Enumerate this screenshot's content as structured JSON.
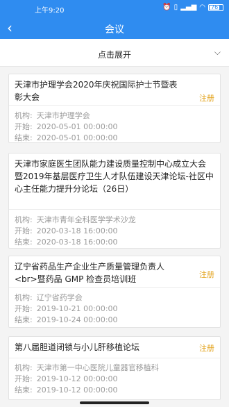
{
  "status": {
    "time": "上午9:20",
    "icons": [
      "alarm-icon",
      "sim-icon",
      "signal-icon",
      "wifi-icon"
    ],
    "battery": "76"
  },
  "header": {
    "title": "会议",
    "accent": "#2f8cf0"
  },
  "expand_bar": {
    "label": "点击展开",
    "icon": "chevron-down-icon"
  },
  "labels": {
    "org": "机构:",
    "start": "开始:",
    "end": "结束:"
  },
  "meetings": [
    {
      "title": "天津市护理学会2020年庆祝国际护士节暨表彰大会",
      "action": "注册",
      "org": "天津市护理学会",
      "start": "2020-05-01 00:00:00",
      "end": "2020-05-01 00:00:00"
    },
    {
      "title": "天津市家庭医生团队能力建设质量控制中心成立大会 暨2019年基层医疗卫生人才队伍建设天津论坛-社区中心主任能力提升分论坛（26日）",
      "action": "",
      "org": "天津市青年全科医学学术沙龙",
      "start": "2020-03-18 16:00:00",
      "end": "2020-03-18 16:00:00"
    },
    {
      "title": "辽宁省药品生产企业生产质量管理负责人<br>暨药品 GMP 检查员培训班",
      "action": "注册",
      "org": "辽宁省药学会",
      "start": "2019-10-21 00:00:00",
      "end": "2019-10-24 00:00:00"
    },
    {
      "title": "第八届胆道闭锁与小儿肝移植论坛",
      "action": "注册",
      "org": "天津市第一中心医院儿童器官移植科",
      "start": "2019-10-12 00:00:00",
      "end": "2019-10-12 00:00:00"
    }
  ]
}
